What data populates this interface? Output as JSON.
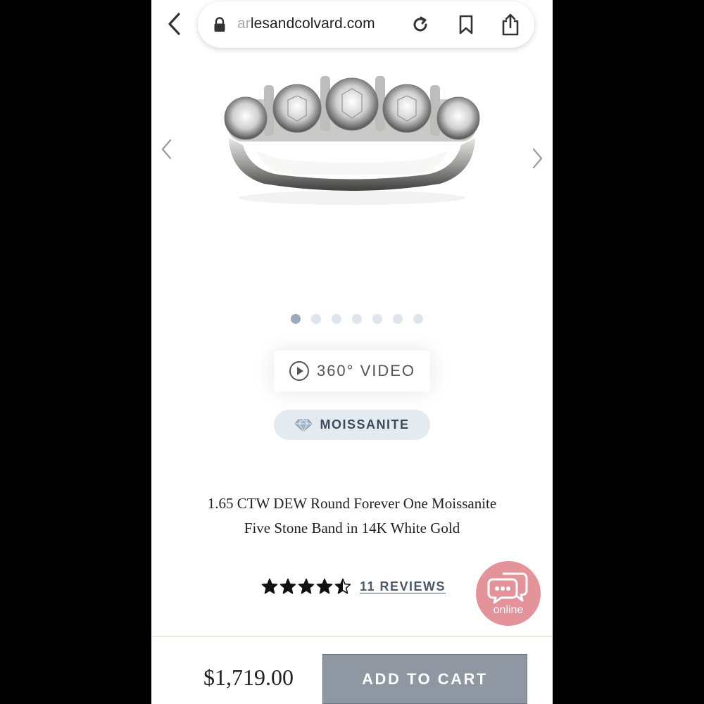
{
  "browser": {
    "url_faded": "ar",
    "url_visible": "lesandcolvard.com"
  },
  "product": {
    "title": "1.65 CTW DEW Round Forever One Moissanite Five Stone Band in 14K White Gold",
    "video_label": "360° VIDEO",
    "badge_label": "MOISSANITE",
    "rating": 4.5,
    "rating_max": 5,
    "reviews_label": "11 REVIEWS",
    "price": "$1,719.00",
    "add_to_cart_label": "ADD TO CART"
  },
  "carousel": {
    "slide_count": 7,
    "active_index": 0
  },
  "chat": {
    "label": "online"
  },
  "colors": {
    "badge_bg": "#e4ebf0",
    "cart_button": "#8f97a2",
    "chat_bubble": "#e28a93",
    "active_dot": "#9aabbd"
  }
}
